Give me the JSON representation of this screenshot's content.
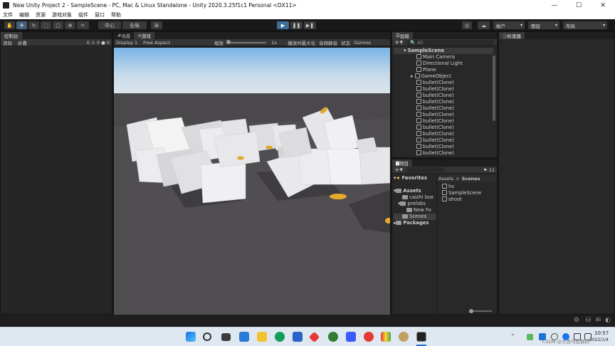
{
  "window": {
    "title": "New Unity Project 2 - SampleScene - PC, Mac & Linux Standalone - Unity 2020.3.25f1c1 Personal <DX11>",
    "minimize": "—",
    "maximize": "☐",
    "close": "✕"
  },
  "menu": [
    "文件",
    "编辑",
    "资源",
    "游戏对象",
    "组件",
    "窗口",
    "帮助"
  ],
  "toolbar": {
    "pivot": "中心",
    "space": "全局",
    "account": "帐户",
    "layers": "图层",
    "layout": "布局"
  },
  "console": {
    "tab": "控制台",
    "clear": "清除",
    "collapse": "折叠",
    "count_warn": "0",
    "count_log": "0",
    "count_err": "0"
  },
  "game": {
    "tab_scene": "场景",
    "tab_game": "游戏",
    "display": "Display 1",
    "aspect": "Free Aspect",
    "scale_label": "缩放",
    "scale_value": "1x",
    "maximize": "播放时最大化",
    "mute": "音频静音",
    "stats": "状态",
    "gizmos": "Gizmos"
  },
  "hierarchy": {
    "tab": "层级",
    "search_placeholder": "All",
    "scene": "SampleScene",
    "items": [
      "Main Camera",
      "Directional Light",
      "Plane",
      "GameObject",
      "bullet(Clone)",
      "bullet(Clone)",
      "bullet(Clone)",
      "bullet(Clone)",
      "bullet(Clone)",
      "bullet(Clone)",
      "bullet(Clone)",
      "bullet(Clone)",
      "bullet(Clone)",
      "bullet(Clone)",
      "bullet(Clone)",
      "bullet(Clone)"
    ]
  },
  "inspector": {
    "tab": "检查器"
  },
  "project": {
    "tab": "项目",
    "count": "11",
    "favorites": "Favorites",
    "assets": "Assets",
    "tree": [
      "caizhi box",
      "prefabs",
      "New Fo",
      "Scenes"
    ],
    "packages": "Packages",
    "breadcrumb_root": "Assets",
    "breadcrumb_sep": ">",
    "breadcrumb_leaf": "Scenes",
    "files": [
      "hv",
      "SampleScene",
      "shoot"
    ]
  },
  "taskbar": {
    "time": "10:57",
    "date": "2022/1/4",
    "watermark": "CSDN @大思与挖数码"
  }
}
